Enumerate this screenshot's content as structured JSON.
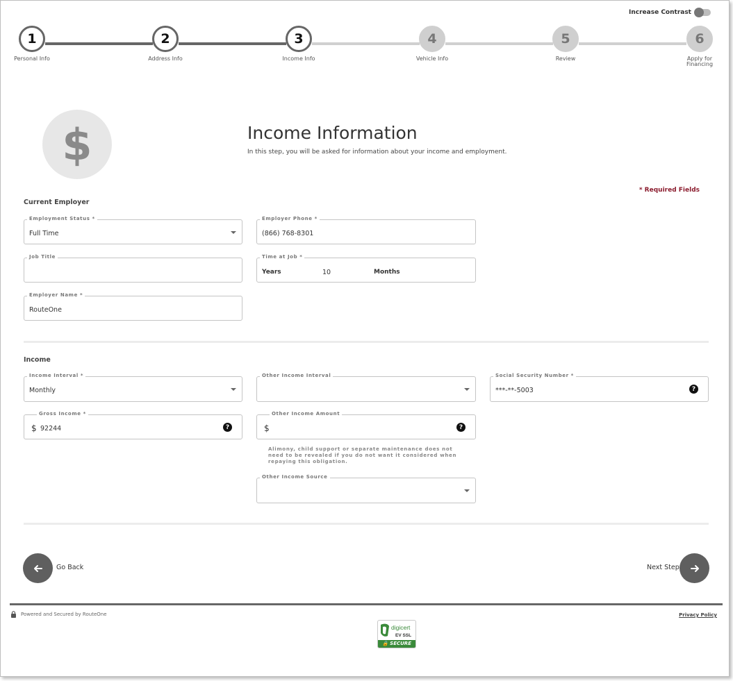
{
  "contrast": {
    "label": "Increase Contrast"
  },
  "stepper": {
    "steps": [
      {
        "number": "1",
        "label": "Personal Info"
      },
      {
        "number": "2",
        "label": "Address Info"
      },
      {
        "number": "3",
        "label": "Income Info"
      },
      {
        "number": "4",
        "label": "Vehicle Info"
      },
      {
        "number": "5",
        "label": "Review"
      },
      {
        "number": "6",
        "label": "Apply for Financing"
      }
    ],
    "current_step": 3
  },
  "header": {
    "icon": "dollar-icon",
    "icon_glyph": "$",
    "title": "Income Information",
    "subtitle": "In this step, you will be asked for information about your income and employment.",
    "required_note": "* Required Fields"
  },
  "employer": {
    "section_title": "Current Employer",
    "employment_status": {
      "label": "Employment Status *",
      "value": "Full Time"
    },
    "employer_phone": {
      "label": "Employer Phone *",
      "value": "(866) 768-8301"
    },
    "job_title": {
      "label": "Job Title",
      "value": ""
    },
    "time_at_job": {
      "label": "Time at Job *",
      "years_label": "Years",
      "years_value": "10",
      "months_label": "Months",
      "months_value": ""
    },
    "employer_name": {
      "label": "Employer Name *",
      "value": "RouteOne"
    }
  },
  "income": {
    "section_title": "Income",
    "income_interval": {
      "label": "Income Interval *",
      "value": "Monthly"
    },
    "other_income_interval": {
      "label": "Other Income Interval",
      "value": ""
    },
    "ssn": {
      "label": "Social Security Number *",
      "value": "***-**-5003"
    },
    "gross_income": {
      "label": "Gross Income *",
      "currency": "$",
      "value": "92244"
    },
    "other_income_amount": {
      "label": "Other Income Amount",
      "currency": "$",
      "value": ""
    },
    "alimony_note": "Alimony, child support or separate maintenance does not need to be revealed if you do not want it considered when repaying this obligation.",
    "other_income_source": {
      "label": "Other Income Source",
      "value": ""
    }
  },
  "nav": {
    "back_label": "Go Back",
    "next_label": "Next Step"
  },
  "footer": {
    "powered_text": "Powered and Secured by RouteOne",
    "privacy_label": "Privacy Policy",
    "seal": {
      "brand": "digicert",
      "type": "EV SSL",
      "status": "SECURE"
    }
  },
  "colors": {
    "step_active": "#666666",
    "step_inactive": "#cfcfcf",
    "required": "#8b1c2e",
    "nav_button": "#5f5f5f",
    "seal_green": "#3a8a3a"
  }
}
